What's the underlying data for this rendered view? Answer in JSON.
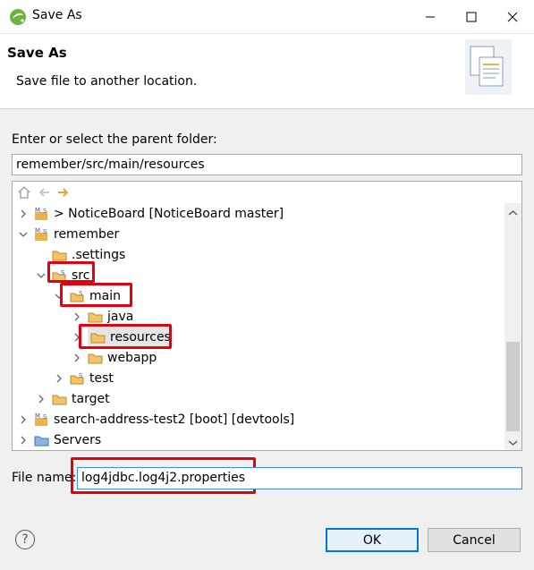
{
  "window": {
    "title": "Save As"
  },
  "header": {
    "title": "Save As",
    "description": "Save file to another location."
  },
  "parent_folder": {
    "label": "Enter or select the parent folder:",
    "value": "remember/src/main/resources"
  },
  "tree": {
    "toolbar": [
      "home-icon",
      "back-arrow-icon",
      "forward-arrow-icon"
    ],
    "items": [
      {
        "label": "> NoticeBoard [NoticeBoard master]",
        "icon": "project-icon",
        "twisty": "collapsed"
      },
      {
        "label": "remember",
        "icon": "project-icon",
        "twisty": "expanded"
      },
      {
        "label": ".settings",
        "icon": "folder-icon",
        "twisty": "none"
      },
      {
        "label": "src",
        "icon": "source-folder-icon",
        "twisty": "expanded"
      },
      {
        "label": "main",
        "icon": "source-folder-icon",
        "twisty": "expanded"
      },
      {
        "label": "java",
        "icon": "folder-icon",
        "twisty": "collapsed"
      },
      {
        "label": "resources",
        "icon": "folder-icon",
        "twisty": "collapsed",
        "selected": true
      },
      {
        "label": "webapp",
        "icon": "folder-icon",
        "twisty": "collapsed"
      },
      {
        "label": "test",
        "icon": "source-folder-icon",
        "twisty": "collapsed"
      },
      {
        "label": "target",
        "icon": "folder-icon",
        "twisty": "collapsed"
      },
      {
        "label": "search-address-test2 [boot] [devtools]",
        "icon": "project-icon",
        "twisty": "collapsed"
      },
      {
        "label": "Servers",
        "icon": "servers-folder-icon",
        "twisty": "collapsed"
      }
    ]
  },
  "file_name": {
    "label": "File name:",
    "value": "log4jdbc.log4j2.properties"
  },
  "buttons": {
    "ok": "OK",
    "cancel": "Cancel",
    "help": "?"
  },
  "colors": {
    "highlight": "#e3000f",
    "folder": "#e8b34a",
    "focus": "#0078d7"
  }
}
